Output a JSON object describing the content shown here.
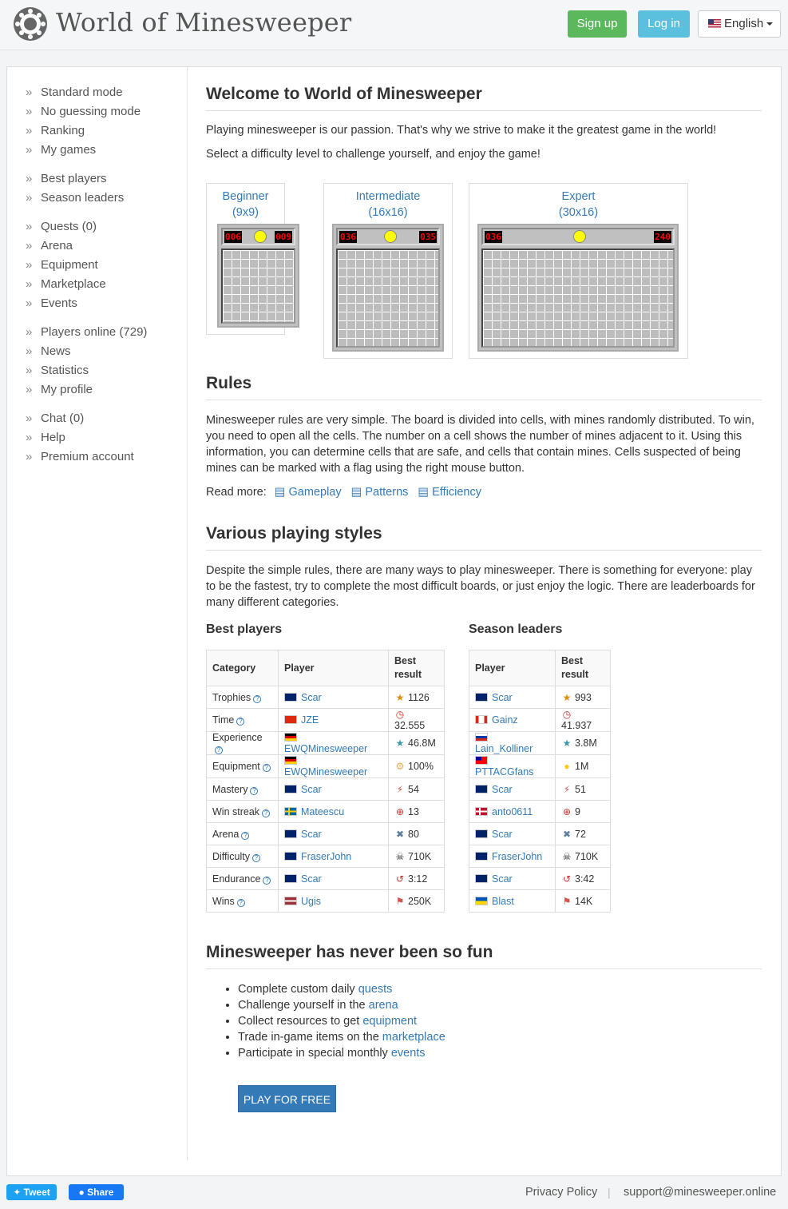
{
  "header": {
    "logo_text": "World of Minesweeper",
    "signup_label": "Sign up",
    "login_label": "Log in",
    "language_label": "English"
  },
  "sidebar": {
    "groups": [
      [
        "Standard mode",
        "No guessing mode",
        "Ranking",
        "My games"
      ],
      [
        "Best players",
        "Season leaders"
      ],
      [
        "Quests (0)",
        "Arena",
        "Equipment",
        "Marketplace",
        "Events"
      ],
      [
        "Players online (729)",
        "News",
        "Statistics",
        "My profile"
      ],
      [
        "Chat (0)",
        "Help",
        "Premium account"
      ]
    ]
  },
  "welcome": {
    "title": "Welcome to World of Minesweeper",
    "p1": "Playing minesweeper is our passion. That's why we strive to make it the greatest game in the world!",
    "p2": "Select a difficulty level to challenge yourself, and enjoy the game!",
    "levels": [
      {
        "name": "Beginner",
        "size": "(9x9)",
        "left": "006",
        "right": "009"
      },
      {
        "name": "Intermediate",
        "size": "(16x16)",
        "left": "036",
        "right": "035"
      },
      {
        "name": "Expert",
        "size": "(30x16)",
        "left": "036",
        "right": "240"
      }
    ]
  },
  "rules": {
    "title": "Rules",
    "text": "Minesweeper rules are very simple. The board is divided into cells, with mines randomly distributed. To win, you need to open all the cells. The number on a cell shows the number of mines adjacent to it. Using this information, you can determine cells that are safe, and cells that contain mines. Cells suspected of being mines can be marked with a flag using the right mouse button.",
    "read_more": "Read more:",
    "links": [
      "Gameplay",
      "Patterns",
      "Efficiency"
    ]
  },
  "styles": {
    "title": "Various playing styles",
    "text": "Despite the simple rules, there are many ways to play minesweeper. There is something for everyone: play to be the fastest, try to complete the most difficult boards, or just enjoy the logic. There are leaderboards for many different categories."
  },
  "best_players": {
    "title": "Best players",
    "headers": [
      "Category",
      "Player",
      "Best result"
    ],
    "rows": [
      {
        "category": "Trophies",
        "player": "Scar",
        "result": "1126",
        "icon": "trophy-icon",
        "flag": "AU"
      },
      {
        "category": "Time",
        "player": "JZE",
        "result": "32.555",
        "icon": "clock-icon",
        "flag": "CN"
      },
      {
        "category": "Experience",
        "player": "EWQMinesweeper",
        "result": "46.8M",
        "icon": "star-icon",
        "flag": "DE"
      },
      {
        "category": "Equipment",
        "player": "EWQMinesweeper",
        "result": "100%",
        "icon": "gear-icon",
        "flag": "DE"
      },
      {
        "category": "Mastery",
        "player": "Scar",
        "result": "54",
        "icon": "bolt-icon",
        "flag": "AU"
      },
      {
        "category": "Win streak",
        "player": "Mateescu",
        "result": "13",
        "icon": "crosshair-icon",
        "flag": "SE"
      },
      {
        "category": "Arena",
        "player": "Scar",
        "result": "80",
        "icon": "swords-icon",
        "flag": "AU"
      },
      {
        "category": "Difficulty",
        "player": "FraserJohn",
        "result": "710K",
        "icon": "skull-icon",
        "flag": "AU"
      },
      {
        "category": "Endurance",
        "player": "Scar",
        "result": "3:12",
        "icon": "history-icon",
        "flag": "AU"
      },
      {
        "category": "Wins",
        "player": "Ugis",
        "result": "250K",
        "icon": "flag-icon",
        "flag": "LV"
      }
    ]
  },
  "season_leaders": {
    "title": "Season leaders",
    "headers": [
      "Player",
      "Best result"
    ],
    "rows": [
      {
        "player": "Scar",
        "result": "993",
        "icon": "trophy-icon",
        "flag": "AU"
      },
      {
        "player": "Gainz",
        "result": "41.937",
        "icon": "clock-icon",
        "flag": "CA"
      },
      {
        "player": "Lain_Kolliner",
        "result": "3.8M",
        "icon": "star-icon",
        "flag": "RU"
      },
      {
        "player": "PTTACGfans",
        "result": "1M",
        "icon": "coin-icon",
        "flag": "TW"
      },
      {
        "player": "Scar",
        "result": "51",
        "icon": "bolt-icon",
        "flag": "AU"
      },
      {
        "player": "anto0611",
        "result": "9",
        "icon": "crosshair-icon",
        "flag": "DK"
      },
      {
        "player": "Scar",
        "result": "72",
        "icon": "swords-icon",
        "flag": "AU"
      },
      {
        "player": "FraserJohn",
        "result": "710K",
        "icon": "skull-icon",
        "flag": "AU"
      },
      {
        "player": "Scar",
        "result": "3:42",
        "icon": "history-icon",
        "flag": "AU"
      },
      {
        "player": "Blast",
        "result": "14K",
        "icon": "flag-icon",
        "flag": "UA"
      }
    ]
  },
  "fun": {
    "title": "Minesweeper has never been so fun",
    "items": [
      {
        "text": "Complete custom daily ",
        "link": "quests"
      },
      {
        "text": "Challenge yourself in the ",
        "link": "arena"
      },
      {
        "text": "Collect resources to get ",
        "link": "equipment"
      },
      {
        "text": "Trade in-game items on the ",
        "link": "marketplace"
      },
      {
        "text": "Participate in special monthly ",
        "link": "events"
      }
    ],
    "play_button": "PLAY FOR FREE"
  },
  "footer": {
    "tweet": "Tweet",
    "share": "Share",
    "privacy": "Privacy Policy",
    "separator": "|",
    "email": "support@minesweeper.online"
  },
  "colors": {
    "accent": "#337ab7",
    "signup": "#5cb85c",
    "login": "#5bc0de"
  }
}
